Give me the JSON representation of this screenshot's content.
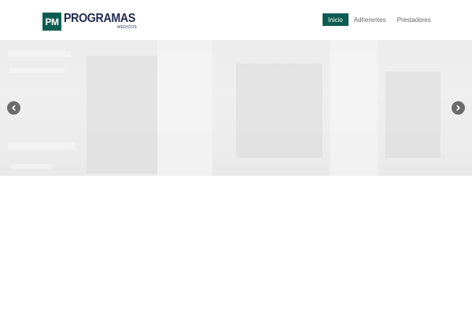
{
  "header": {
    "logo": {
      "badge": "PM",
      "title": "PROGRAMAS",
      "subtitle": "MÉDICOS"
    },
    "nav": {
      "items": [
        {
          "label": "Inicio",
          "active": true
        },
        {
          "label": "Adherentes",
          "active": false
        },
        {
          "label": "Prestadores",
          "active": false
        }
      ]
    }
  },
  "slider": {
    "prev_icon": "chevron-left-icon",
    "next_icon": "chevron-right-icon"
  },
  "colors": {
    "brand": "#0c5c52",
    "logo_text": "#1e2b4d",
    "nav_text": "#666666",
    "slider_bg": "#ececec",
    "arrow_bg": "#6b6b6b"
  }
}
